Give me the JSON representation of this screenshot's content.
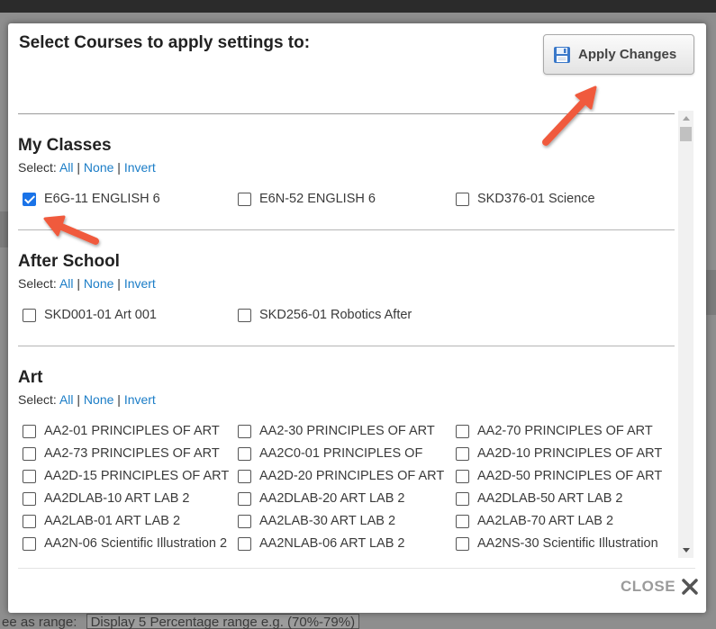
{
  "modal": {
    "title": "Select Courses to apply settings to:",
    "apply_button_label": "Apply Changes",
    "close_label": "CLOSE"
  },
  "select_labels": {
    "prefix": "Select:",
    "all": "All",
    "none": "None",
    "invert": "Invert",
    "separator": "|"
  },
  "sections": [
    {
      "title": "My Classes",
      "courses": [
        {
          "label": "E6G-11 ENGLISH 6",
          "checked": true
        },
        {
          "label": "E6N-52 ENGLISH 6",
          "checked": false
        },
        {
          "label": "SKD376-01 Science",
          "checked": false
        }
      ]
    },
    {
      "title": "After School",
      "courses": [
        {
          "label": "SKD001-01 Art 001",
          "checked": false
        },
        {
          "label": "SKD256-01 Robotics After",
          "checked": false
        }
      ]
    },
    {
      "title": "Art",
      "courses": [
        {
          "label": "AA2-01 PRINCIPLES OF ART",
          "checked": false
        },
        {
          "label": "AA2-30 PRINCIPLES OF ART",
          "checked": false
        },
        {
          "label": "AA2-70 PRINCIPLES OF ART",
          "checked": false
        },
        {
          "label": "AA2-73 PRINCIPLES OF ART",
          "checked": false
        },
        {
          "label": "AA2C0-01 PRINCIPLES OF",
          "checked": false
        },
        {
          "label": "AA2D-10 PRINCIPLES OF ART",
          "checked": false
        },
        {
          "label": "AA2D-15 PRINCIPLES OF ART",
          "checked": false
        },
        {
          "label": "AA2D-20 PRINCIPLES OF ART",
          "checked": false
        },
        {
          "label": "AA2D-50 PRINCIPLES OF ART",
          "checked": false
        },
        {
          "label": "AA2DLAB-10 ART LAB 2",
          "checked": false
        },
        {
          "label": "AA2DLAB-20 ART LAB 2",
          "checked": false
        },
        {
          "label": "AA2DLAB-50 ART LAB 2",
          "checked": false
        },
        {
          "label": "AA2LAB-01 ART LAB 2",
          "checked": false
        },
        {
          "label": "AA2LAB-30 ART LAB 2",
          "checked": false
        },
        {
          "label": "AA2LAB-70 ART LAB 2",
          "checked": false
        },
        {
          "label": "AA2N-06 Scientific Illustration 2",
          "checked": false
        },
        {
          "label": "AA2NLAB-06 ART LAB 2",
          "checked": false
        },
        {
          "label": "AA2NS-30 Scientific Illustration",
          "checked": false
        }
      ]
    }
  ],
  "background_page": {
    "bottom_text": "ee as range:",
    "bottom_select_value": "Display 5 Percentage range e.g. (70%-79%)"
  },
  "colors": {
    "link": "#1b7dc7",
    "annotation_arrow": "#f05a3c",
    "checkbox_checked": "#1a73e8"
  },
  "icons": [
    "save-icon",
    "close-icon",
    "annotation-arrow-icon",
    "scroll-up-icon",
    "scroll-down-icon"
  ]
}
